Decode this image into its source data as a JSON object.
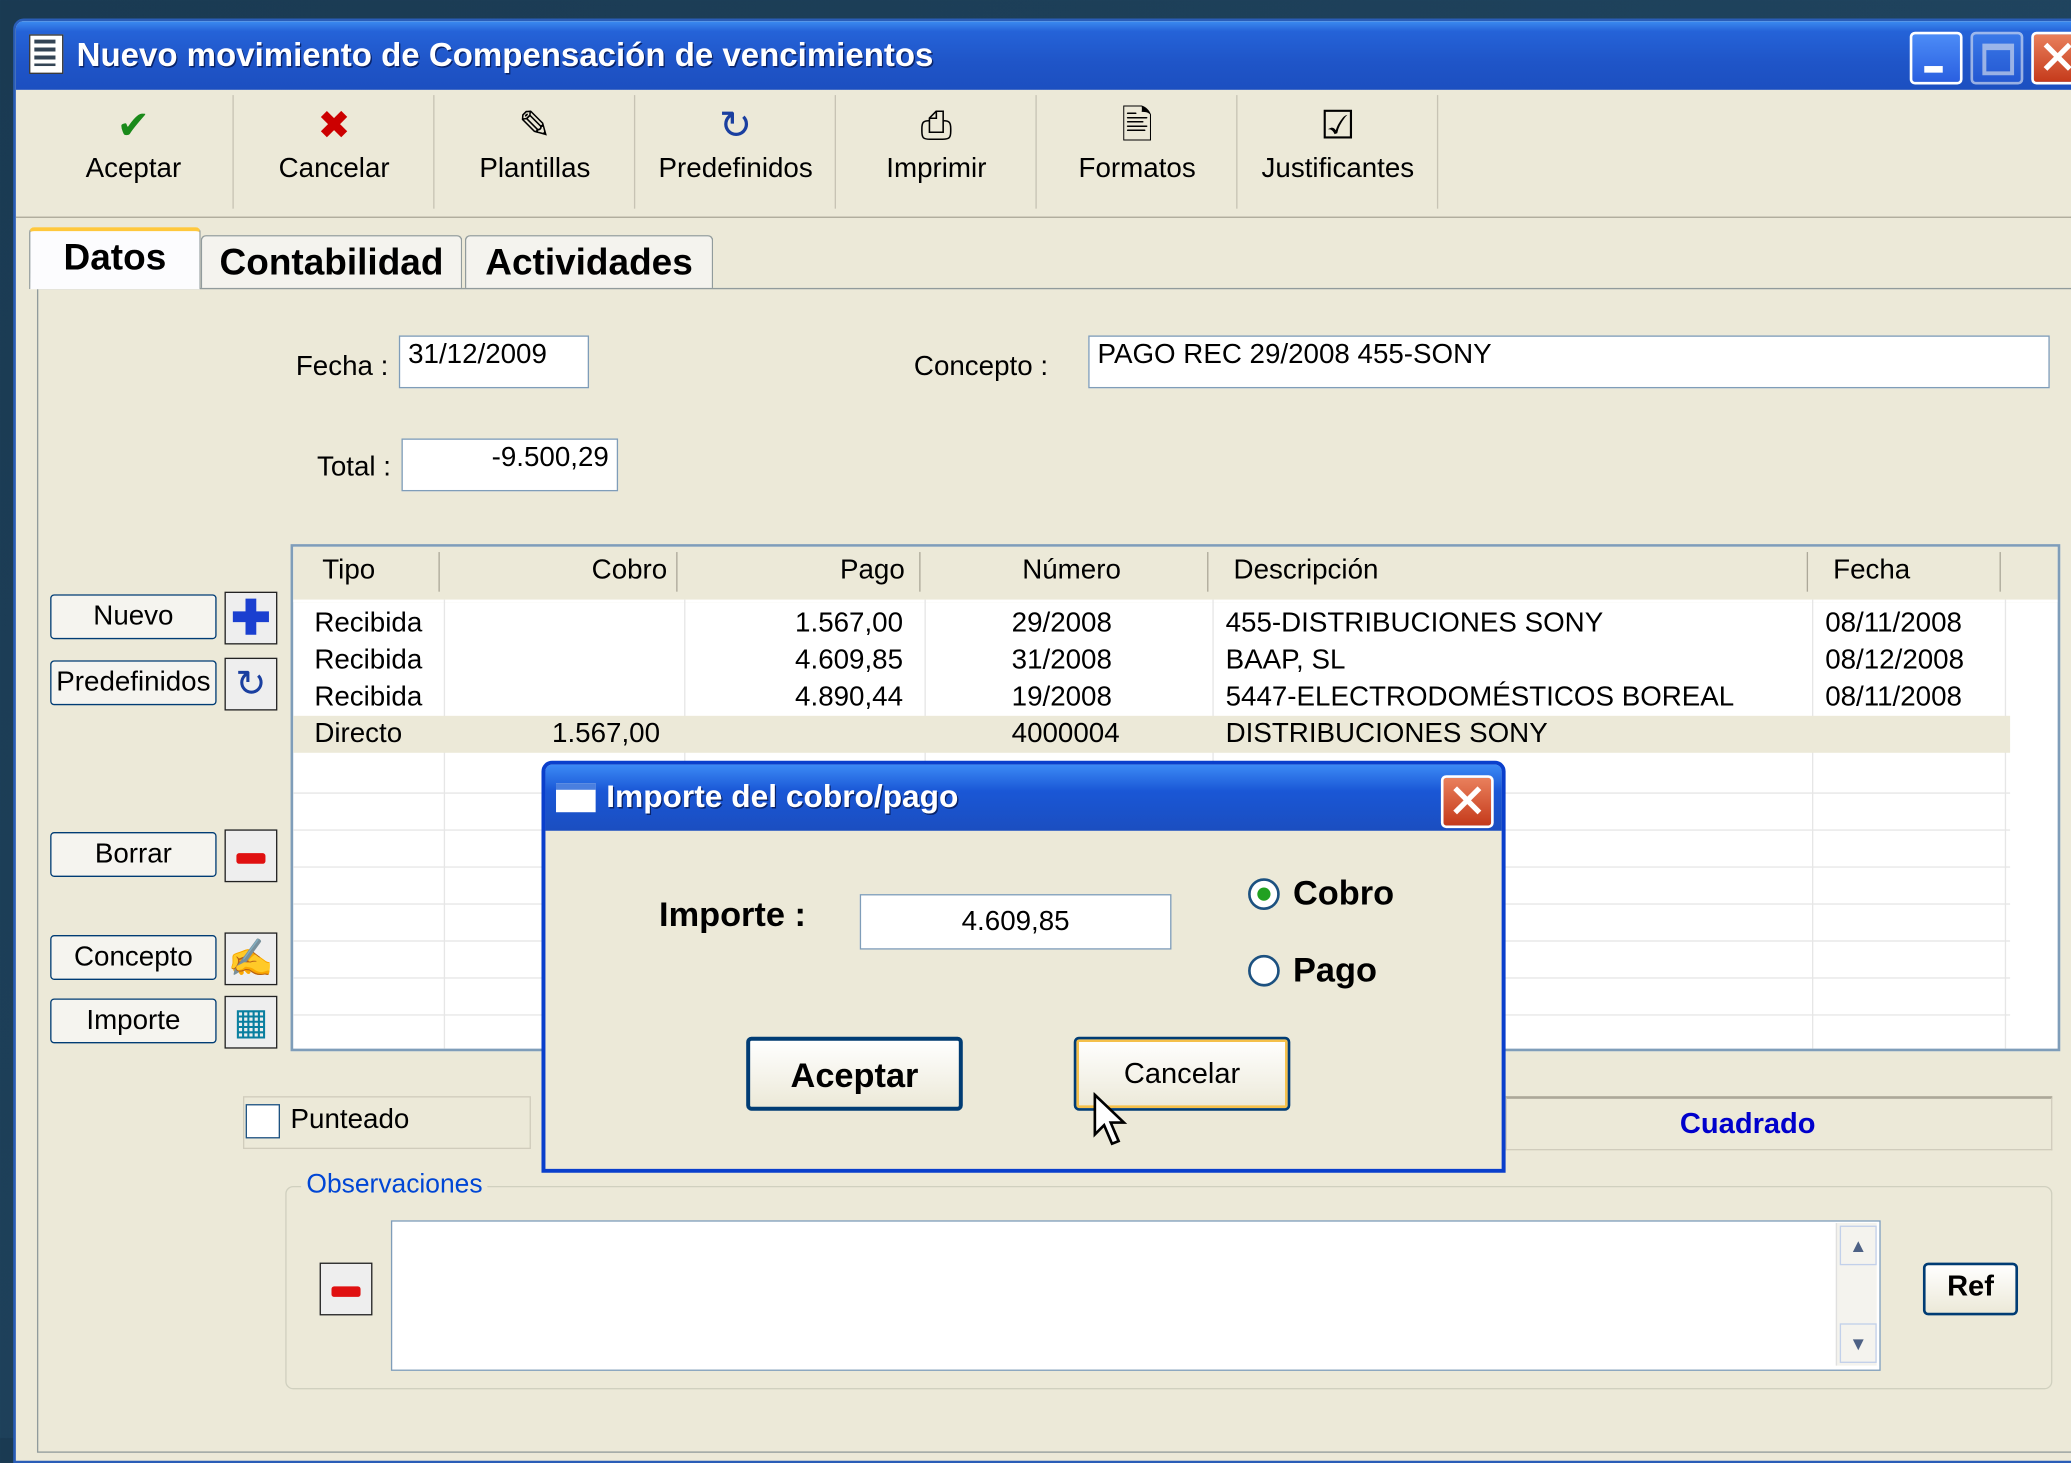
{
  "window": {
    "title": "Nuevo movimiento de Compensación de vencimientos"
  },
  "toolbar": {
    "items": [
      {
        "label": "Aceptar",
        "icon": "check-icon"
      },
      {
        "label": "Cancelar",
        "icon": "x-icon"
      },
      {
        "label": "Plantillas",
        "icon": "templates-icon"
      },
      {
        "label": "Predefinidos",
        "icon": "predefined-icon"
      },
      {
        "label": "Imprimir",
        "icon": "printer-icon"
      },
      {
        "label": "Formatos",
        "icon": "formats-icon"
      },
      {
        "label": "Justificantes",
        "icon": "receipts-icon"
      }
    ]
  },
  "tabs": [
    "Datos",
    "Contabilidad",
    "Actividades"
  ],
  "form": {
    "fecha_label": "Fecha :",
    "fecha_value": "31/12/2009",
    "concepto_label": "Concepto :",
    "concepto_value": "PAGO REC 29/2008 455-SONY",
    "total_label": "Total :",
    "total_value": "-9.500,29"
  },
  "grid": {
    "columns": [
      "Tipo",
      "Cobro",
      "Pago",
      "Número",
      "Descripción",
      "Fecha"
    ],
    "rows": [
      [
        "Recibida",
        "",
        "1.567,00",
        "29/2008",
        "455-DISTRIBUCIONES SONY",
        "08/11/2008"
      ],
      [
        "Recibida",
        "",
        "4.609,85",
        "31/2008",
        "BAAP, SL",
        "08/12/2008"
      ],
      [
        "Recibida",
        "",
        "4.890,44",
        "19/2008",
        "5447-ELECTRODOMÉSTICOS BOREAL",
        "08/11/2008"
      ],
      [
        "Directo",
        "1.567,00",
        "",
        "4000004",
        "DISTRIBUCIONES SONY",
        ""
      ]
    ]
  },
  "side_buttons": {
    "nuevo": "Nuevo",
    "predefinidos": "Predefinidos",
    "borrar": "Borrar",
    "concepto": "Concepto",
    "importe": "Importe"
  },
  "punteado_label": "Punteado",
  "status": {
    "text": "Cuadrado",
    "color": "#0000cc"
  },
  "observaciones": {
    "label": "Observaciones",
    "ref": "Ref"
  },
  "dialog": {
    "title": "Importe del cobro/pago",
    "importe_label": "Importe :",
    "importe_value": "4.609,85",
    "radio_cobro": "Cobro",
    "radio_pago": "Pago",
    "selected": "Cobro",
    "ok": "Aceptar",
    "cancel": "Cancelar"
  }
}
